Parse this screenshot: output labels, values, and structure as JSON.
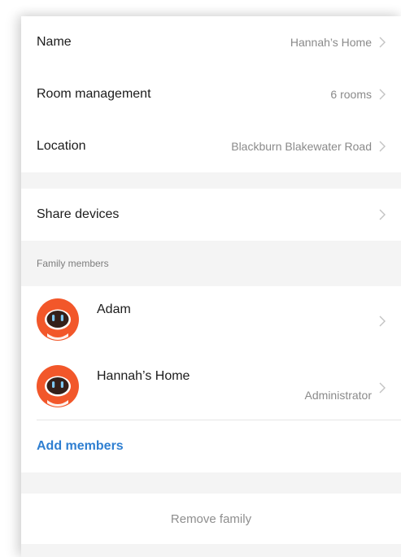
{
  "settings": {
    "name": {
      "label": "Name",
      "value": "Hannah’s Home"
    },
    "rooms": {
      "label": "Room management",
      "value": "6 rooms"
    },
    "location": {
      "label": "Location",
      "value": "Blackburn Blakewater Road"
    },
    "share": {
      "label": "Share devices"
    }
  },
  "family": {
    "header": "Family members",
    "members": [
      {
        "name": "Adam",
        "role": "",
        "avatar": "robot-avatar-icon"
      },
      {
        "name": "Hannah’s Home",
        "role": "Administrator",
        "avatar": "robot-avatar-icon"
      }
    ],
    "add_label": "Add members"
  },
  "actions": {
    "remove_label": "Remove family"
  },
  "colors": {
    "accent": "#2f7fd1",
    "avatar_orange": "#f2572a",
    "muted_text": "#8a8a8a",
    "section_bg": "#f4f4f4"
  }
}
